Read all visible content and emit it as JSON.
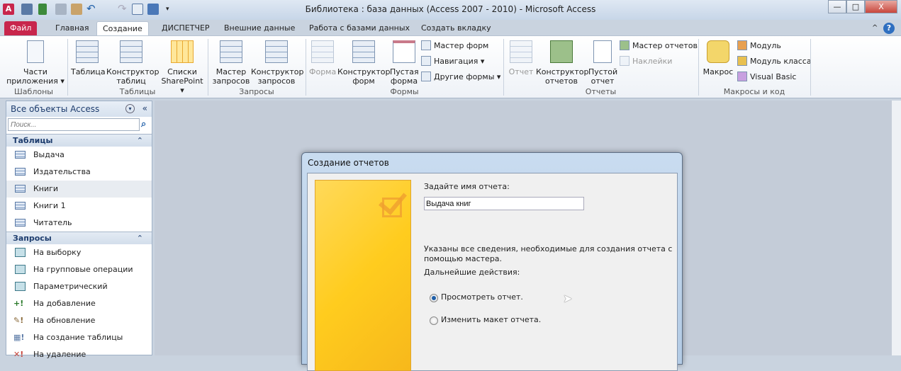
{
  "window": {
    "title": "Библиотека : база данных (Access 2007 - 2010)  -  Microsoft Access",
    "app_icon": "A",
    "minimize": "—",
    "maximize": "□",
    "close": "X",
    "help": "?",
    "collapse_ribbon": "^"
  },
  "tabs": [
    "Файл",
    "Главная",
    "Создание",
    "ДИСПЕТЧЕР",
    "Внешние данные",
    "Работа с базами данных",
    "Создать вкладку"
  ],
  "ribbon": {
    "groups": [
      "Шаблоны",
      "Таблицы",
      "Запросы",
      "Формы",
      "Отчеты",
      "Макросы и код"
    ],
    "templates": {
      "app_parts": "Части приложения"
    },
    "tables": {
      "table": "Таблица",
      "table_design": "Конструктор таблиц",
      "sharepoint": "Списки SharePoint"
    },
    "queries": {
      "wizard": "Мастер запросов",
      "design": "Конструктор запросов"
    },
    "forms": {
      "form": "Форма",
      "design": "Конструктор форм",
      "blank": "Пустая форма",
      "wizard": "Мастер форм",
      "navigation": "Навигация",
      "other": "Другие формы"
    },
    "reports": {
      "report": "Отчет",
      "design": "Конструктор отчетов",
      "blank": "Пустой отчет",
      "wizard": "Мастер отчетов",
      "labels": "Наклейки"
    },
    "macros": {
      "macro": "Макрос",
      "module": "Модуль",
      "class_module": "Модуль класса",
      "vb": "Visual Basic"
    }
  },
  "nav": {
    "title": "Все объекты Access",
    "search_placeholder": "Поиск...",
    "collapse": "«",
    "groups": [
      {
        "label": "Таблицы",
        "items": [
          "Выдача",
          "Издательства",
          "Книги",
          "Книги 1",
          "Читатель"
        ]
      },
      {
        "label": "Запросы",
        "items": [
          "На выборку",
          "На групповые операции",
          "Параметрический",
          "На добавление",
          "На обновление",
          "На создание таблицы",
          "На удаление"
        ]
      }
    ]
  },
  "dialog": {
    "title": "Создание отчетов",
    "name_prompt": "Задайте имя отчета:",
    "name_value": "Выдача книг",
    "info": "Указаны все сведения, необходимые для создания отчета с помощью мастера.",
    "next_label": "Дальнейшие действия:",
    "options": [
      "Просмотреть отчет.",
      "Изменить макет отчета."
    ],
    "selected": 0
  }
}
